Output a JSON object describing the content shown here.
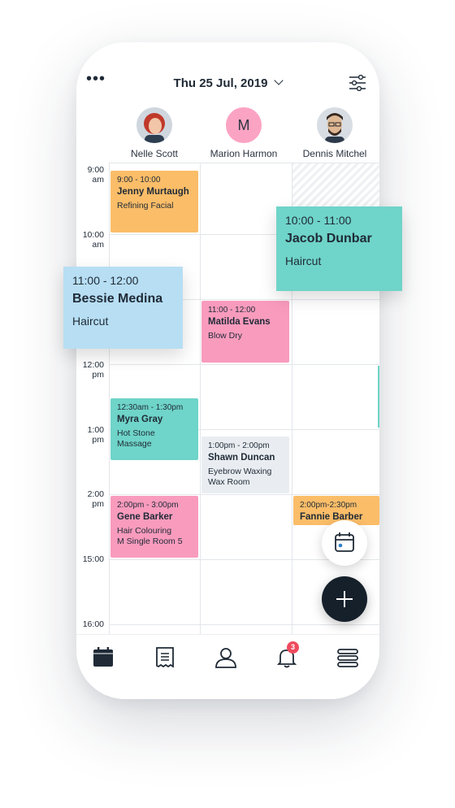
{
  "header": {
    "menu_glyph": "•••",
    "date": "Thu 25 Jul, 2019",
    "icons": [
      "more-icon",
      "chevron-down-icon",
      "filter-sliders-icon"
    ]
  },
  "staff": [
    {
      "name": "Nelle Scott",
      "avatar": "photo"
    },
    {
      "name": "Marion Harmon",
      "initial": "M",
      "color": "#fba3c3"
    },
    {
      "name": "Dennis Mitchel",
      "avatar": "photo"
    }
  ],
  "times": [
    {
      "label1": "9:00",
      "label2": "am"
    },
    {
      "label1": "10:00",
      "label2": "am"
    },
    {
      "label1": "12:00",
      "label2": "pm"
    },
    {
      "label1": "1:00",
      "label2": "pm"
    },
    {
      "label1": "2:00",
      "label2": "pm"
    },
    {
      "label1": "15:00",
      "label2": ""
    },
    {
      "label1": "16:00",
      "label2": ""
    }
  ],
  "appointments": [
    {
      "time": "9:00 - 10:00",
      "name": "Jenny Murtaugh",
      "service": "Refining Facial",
      "color": "#fbbd68"
    },
    {
      "time": "11:00 - 12:00",
      "name": "Matilda Evans",
      "service": "Blow Dry",
      "color": "#f99bbd"
    },
    {
      "time": "12:30am - 1:30pm",
      "name": "Myra Gray",
      "service": "Hot Stone",
      "service2": "Massage",
      "color": "#6fd4c9"
    },
    {
      "time": "1:00pm - 2:00pm",
      "name": "Shawn Duncan",
      "service": "Eyebrow Waxing",
      "service2": "Wax Room",
      "color": "#e9edf1"
    },
    {
      "time": "2:00pm - 3:00pm",
      "name": "Gene Barker",
      "service": "Hair Colouring",
      "service2": "M Single Room 5",
      "color": "#f99bbd"
    },
    {
      "time": "2:00pm-2:30pm",
      "name": "Fannie Barber",
      "color": "#fbbd68"
    }
  ],
  "floating_cards": [
    {
      "time": "10:00 - 11:00",
      "name": "Jacob Dunbar",
      "service": "Haircut",
      "color": "#6fd4c9"
    },
    {
      "time": "11:00 - 12:00",
      "name": "Bessie Medina",
      "service": "Haircut",
      "color": "#b7def3"
    }
  ],
  "nav": {
    "items": [
      "calendar-icon",
      "receipt-icon",
      "user-icon",
      "bell-icon",
      "menu-stack-icon"
    ],
    "badge": "3"
  },
  "fab": {
    "icons": [
      "calendar-small-icon",
      "plus-icon"
    ]
  }
}
